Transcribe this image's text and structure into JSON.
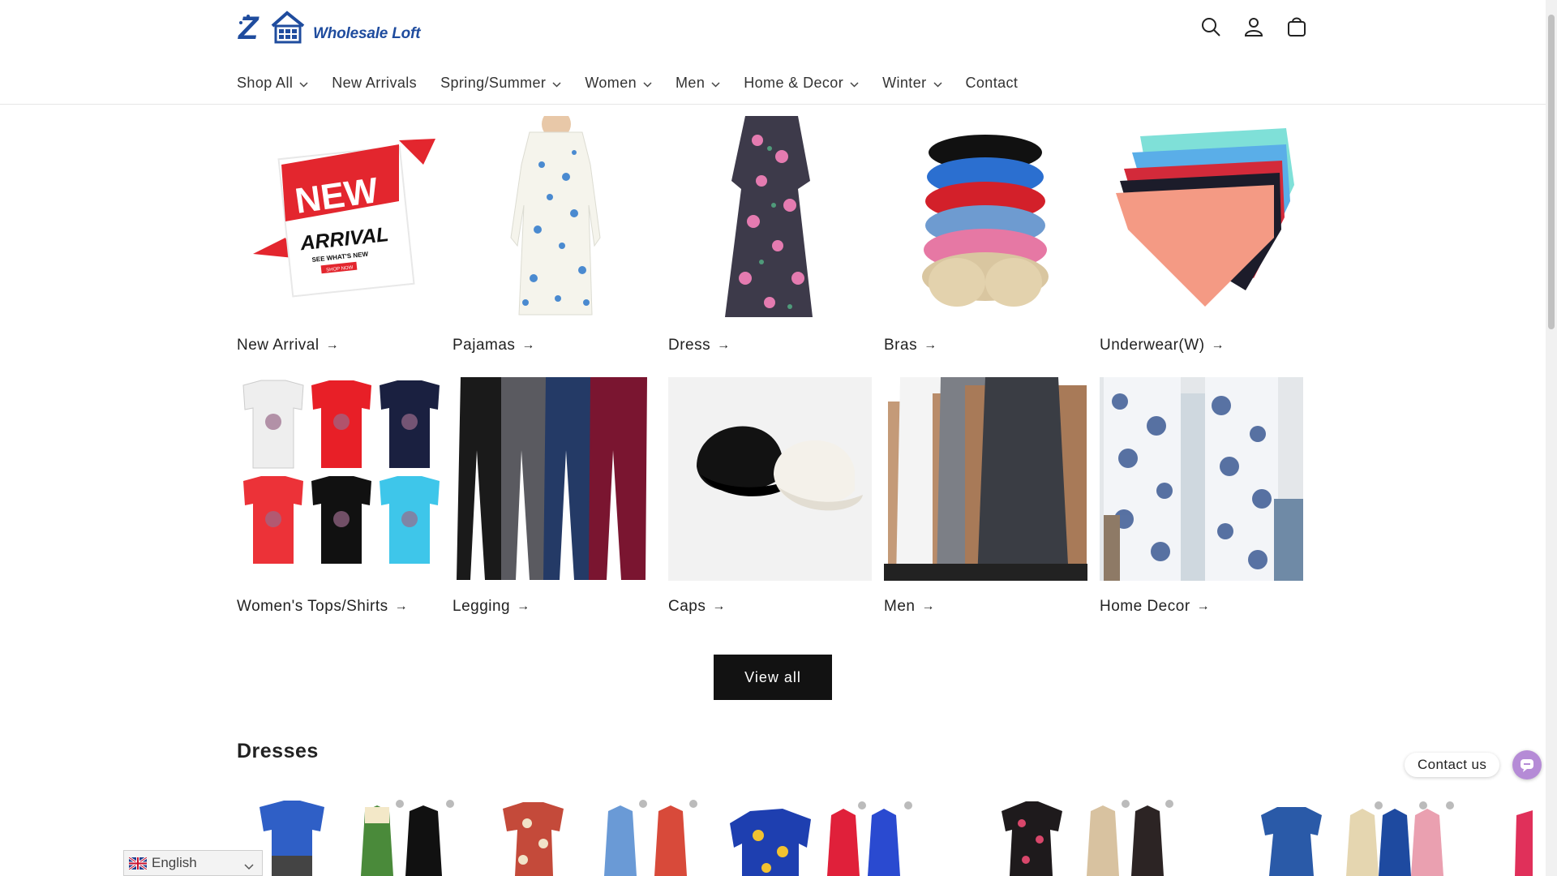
{
  "brand": {
    "logo_text": "Wholesale Loft",
    "primary_color": "#1f4c9e"
  },
  "header": {
    "icons": [
      "search-icon",
      "account-icon",
      "cart-icon"
    ],
    "nav": [
      {
        "label": "Shop All",
        "dropdown": true
      },
      {
        "label": "New Arrivals",
        "dropdown": false
      },
      {
        "label": "Spring/Summer",
        "dropdown": true
      },
      {
        "label": "Women",
        "dropdown": true
      },
      {
        "label": "Men",
        "dropdown": true
      },
      {
        "label": "Home & Decor",
        "dropdown": true
      },
      {
        "label": "Winter",
        "dropdown": true
      },
      {
        "label": "Contact",
        "dropdown": false
      }
    ]
  },
  "collections": [
    {
      "label": "New Arrival",
      "image": "new-arrival-banner"
    },
    {
      "label": "Pajamas",
      "image": "floral-nightgown"
    },
    {
      "label": "Dress",
      "image": "floral-wrap-dress"
    },
    {
      "label": "Bras",
      "image": "stacked-bras"
    },
    {
      "label": "Underwear(W)",
      "image": "lace-panties"
    },
    {
      "label": "Women's Tops/Shirts",
      "image": "graphic-tees"
    },
    {
      "label": "Legging",
      "image": "leggings"
    },
    {
      "label": "Caps",
      "image": "baseball-caps"
    },
    {
      "label": "Men",
      "image": "tank-tops"
    },
    {
      "label": "Home Decor",
      "image": "floral-curtains"
    }
  ],
  "banner": {
    "new": "NEW",
    "arrival": "ARRIVAL",
    "see": "SEE WHAT'S NEW",
    "shop": "SHOP NOW"
  },
  "view_all_label": "View all",
  "section_title": "Dresses",
  "language": {
    "selected": "English"
  },
  "contact_label": "Contact us",
  "colors": {
    "button": "#121212",
    "contact_accent": "#b58bd6"
  }
}
